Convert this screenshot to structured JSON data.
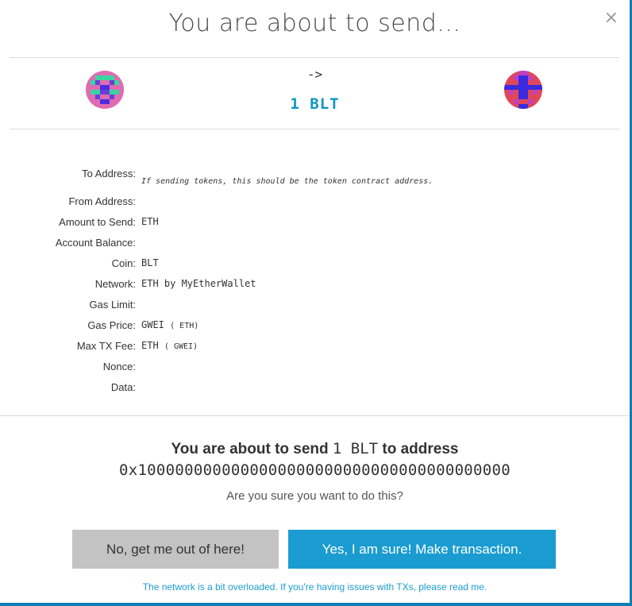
{
  "modal": {
    "title": "You are about to send...",
    "close_label": "×"
  },
  "summary": {
    "arrow": "->",
    "amount": "1 BLT",
    "from_identicon": "from-identicon",
    "to_identicon": "to-identicon"
  },
  "details": {
    "to_address": {
      "label": "To Address:",
      "hint": "If sending tokens, this should be the token contract address."
    },
    "from_address": {
      "label": "From Address:",
      "value": ""
    },
    "amount": {
      "label": "Amount to Send:",
      "value": "ETH"
    },
    "balance": {
      "label": "Account Balance:",
      "value": ""
    },
    "coin": {
      "label": "Coin:",
      "value": "BLT"
    },
    "network": {
      "label": "Network:",
      "value": "ETH by MyEtherWallet"
    },
    "gas_limit": {
      "label": "Gas Limit:",
      "value": ""
    },
    "gas_price": {
      "label": "Gas Price:",
      "value": "GWEI",
      "sub": "( ETH)"
    },
    "max_fee": {
      "label": "Max TX Fee:",
      "value": "ETH",
      "sub": "( GWEI)"
    },
    "nonce": {
      "label": "Nonce:",
      "value": ""
    },
    "data": {
      "label": "Data:",
      "value": ""
    }
  },
  "confirm": {
    "prefix": "You are about to send",
    "amount": "1 BLT",
    "suffix": "to address",
    "address": "0x1000000000000000000000000000000000000000",
    "question": "Are you sure you want to do this?"
  },
  "buttons": {
    "no_label": "No, get me out of here!",
    "yes_label": "Yes, I am sure! Make transaction."
  },
  "footer": {
    "note": "The network is a bit overloaded. If you're having issues with TXs, please read me."
  },
  "colors": {
    "accent": "#1b9cd0",
    "amount": "#0e97c0",
    "cancel_bg": "#c3c3c3",
    "backdrop": "#0e7eb4"
  }
}
